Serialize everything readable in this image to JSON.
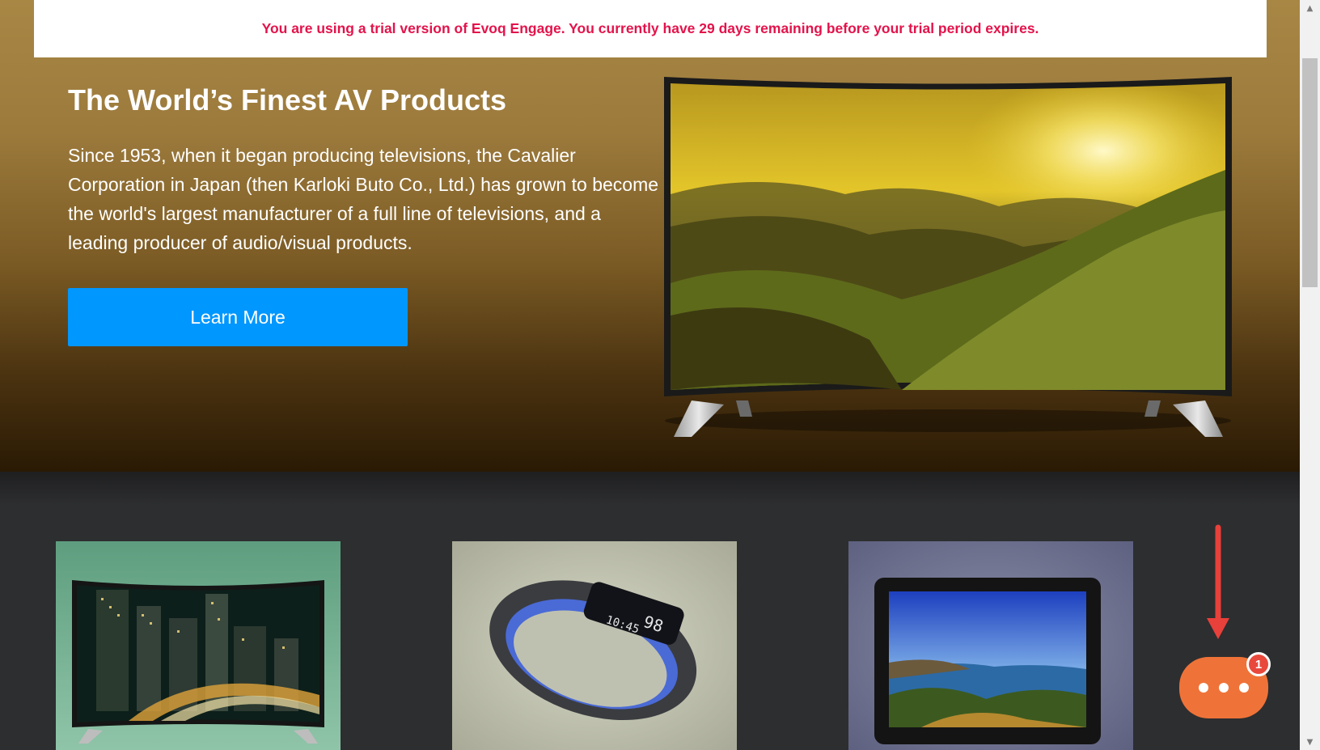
{
  "trial_banner": {
    "text": "You are using a trial version of Evoq Engage. You currently have 29 days remaining before your trial period expires."
  },
  "hero": {
    "title": "The World’s Finest AV Products",
    "body": "Since 1953, when it began producing televisions, the Cavalier Corporation in Japan (then Karloki Buto Co., Ltd.) has grown to become the world's largest manufacturer of a full line of televisions, and a leading producer of audio/visual products.",
    "cta_label": "Learn More",
    "image_icon": "curved-tv-landscape"
  },
  "products": [
    {
      "icon": "curved-tv-city-night",
      "bg": "#6aa88a"
    },
    {
      "icon": "fitness-band",
      "bg": "#bfc1b0",
      "screen_value": "98",
      "screen_time": "10:45"
    },
    {
      "icon": "tablet-landscape",
      "bg": "#6c6f88"
    }
  ],
  "chat": {
    "badge_count": "1",
    "icon": "chat-ellipsis-icon",
    "color": "#ef7338"
  },
  "annotation": {
    "icon": "red-arrow-down",
    "color": "#e8403a"
  },
  "colors": {
    "trial_text": "#e3134b",
    "cta": "#0097ff",
    "dark_bg": "#2d2e30"
  }
}
